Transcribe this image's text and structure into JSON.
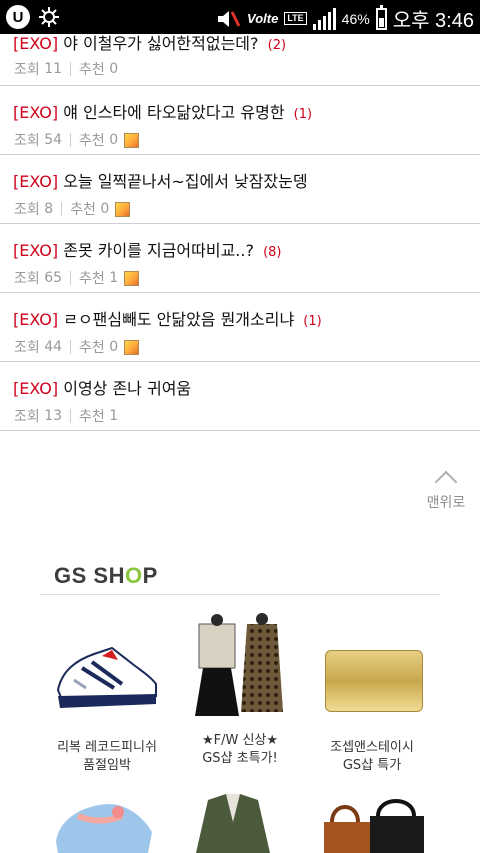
{
  "status_bar": {
    "carrier": "Volte",
    "network": "LTE",
    "battery_percent": "46%",
    "battery_level": 0.46,
    "time": "오후 3:46"
  },
  "posts": [
    {
      "tag": "[EXO]",
      "title": "야 이철우가 싫어한적없는데?",
      "comments": "(2)",
      "views_label": "조회",
      "views": "11",
      "rec_label": "추천",
      "rec": "0",
      "has_image": false
    },
    {
      "tag": "[EXO]",
      "title": "얘 인스타에 타오닮았다고 유명한",
      "comments": "(1)",
      "views_label": "조회",
      "views": "54",
      "rec_label": "추천",
      "rec": "0",
      "has_image": true
    },
    {
      "tag": "[EXO]",
      "title": "오늘 일찍끝나서~집에서 낮잠잤눈뎅",
      "comments": "",
      "views_label": "조회",
      "views": "8",
      "rec_label": "추천",
      "rec": "0",
      "has_image": true
    },
    {
      "tag": "[EXO]",
      "title": "존못 카이를 지금어따비교..?",
      "comments": "(8)",
      "views_label": "조회",
      "views": "65",
      "rec_label": "추천",
      "rec": "1",
      "has_image": true
    },
    {
      "tag": "[EXO]",
      "title": "ㄹㅇ팬심빼도 안닮았음 뭔개소리냐",
      "comments": "(1)",
      "views_label": "조회",
      "views": "44",
      "rec_label": "추천",
      "rec": "0",
      "has_image": true
    },
    {
      "tag": "[EXO]",
      "title": "이영상 존나 귀여움",
      "comments": "",
      "views_label": "조회",
      "views": "13",
      "rec_label": "추천",
      "rec": "1",
      "has_image": false
    }
  ],
  "back_to_top": "맨위로",
  "shop": {
    "brand_a": "GS SH",
    "brand_o": "O",
    "brand_b": "P",
    "products": [
      {
        "line1": "리복 레코드피니쉬",
        "line2": "품절임박",
        "icon": "sneaker-icon"
      },
      {
        "line1": "★F/W 신상★",
        "line2": "GS샵 초특가!",
        "icon": "dress-icon"
      },
      {
        "line1": "조셉앤스테이시",
        "line2": "GS샵 특가",
        "icon": "clutch-bag-icon"
      }
    ]
  }
}
